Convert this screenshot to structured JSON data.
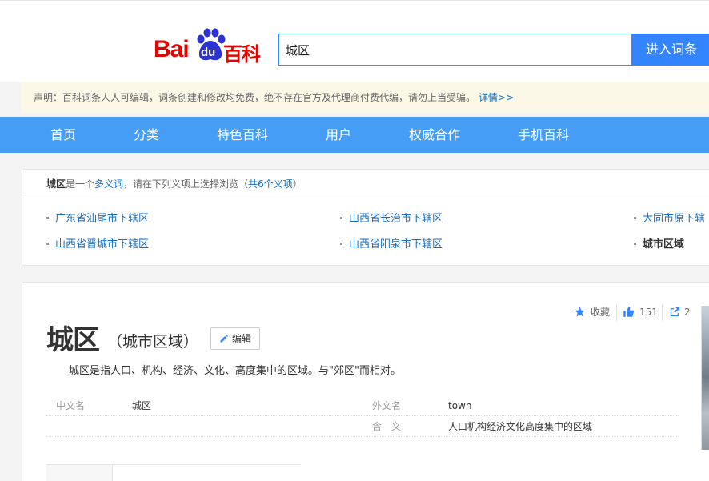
{
  "search": {
    "value": "城区",
    "button_label": "进入词条"
  },
  "logo": {
    "bai": "Bai",
    "du": "du",
    "baike": "百科"
  },
  "notice": {
    "text": "声明：百科词条人人可编辑，词条创建和修改均免费，绝不存在官方及代理商付费代编，请勿上当受骗。",
    "more": "详情>>"
  },
  "nav": {
    "items": [
      "首页",
      "分类",
      "特色百科",
      "用户",
      "权威合作",
      "手机百科"
    ]
  },
  "disambiguation": {
    "term": "城区",
    "text_mid": "是一个",
    "link": "多义词",
    "text_after": "，请在下列义项上选择浏览（",
    "count": "共6个义项",
    "text_end": "）",
    "senses": [
      "广东省汕尾市下辖区",
      "山西省长治市下辖区",
      "大同市原下辖",
      "山西省晋城市下辖区",
      "山西省阳泉市下辖区",
      "城市区域"
    ]
  },
  "tools": {
    "favorite": "收藏",
    "likes": "151",
    "shares": "2"
  },
  "entry": {
    "title": "城区",
    "subtitle": "（城市区域）",
    "edit_label": "编辑",
    "summary": "城区是指人口、机构、经济、文化、高度集中的区域。与\"郊区\"而相对。"
  },
  "basic_info": {
    "rows": [
      {
        "k1": "中文名",
        "v1": "城区",
        "k2": "外文名",
        "v2": "town"
      },
      {
        "k1": "",
        "v1": "",
        "k2": "含　义",
        "v2": "人口机构经济文化高度集中的区域"
      }
    ]
  },
  "colors": {
    "brand_blue": "#3385ff",
    "nav_blue": "#459df5",
    "link_blue": "#136ec2",
    "logo_red": "#e10601"
  }
}
